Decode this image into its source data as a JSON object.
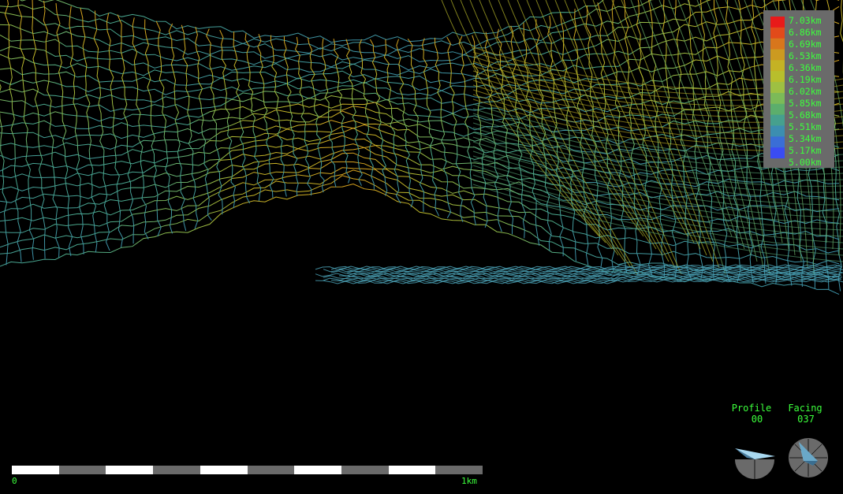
{
  "view": {
    "type": "3d-terrain-wireframe",
    "background": "#000000"
  },
  "legend": {
    "labels": [
      "7.03km",
      "6.86km",
      "6.69km",
      "6.53km",
      "6.36km",
      "6.19km",
      "6.02km",
      "5.85km",
      "5.68km",
      "5.51km",
      "5.34km",
      "5.17km",
      "5.00km"
    ],
    "colors": [
      "#e81a1a",
      "#e24a1a",
      "#d8761c",
      "#cc9a20",
      "#c4b224",
      "#b8be2c",
      "#9ec042",
      "#7cba58",
      "#5cae6c",
      "#46a08e",
      "#3c8eb0",
      "#3a6ed6",
      "#3a4cf2"
    ],
    "label_color": "#3cff3c",
    "background": "#6a6a6a"
  },
  "scale": {
    "start_label": "0",
    "end_label": "1km",
    "segments": 10,
    "colors": [
      "#ffffff",
      "#6a6a6a"
    ]
  },
  "profile": {
    "label": "Profile",
    "value": "00"
  },
  "facing": {
    "label": "Facing",
    "value": "037"
  },
  "compass_icons": {
    "profile": "profile-indicator-icon",
    "facing": "compass-rose-icon"
  }
}
